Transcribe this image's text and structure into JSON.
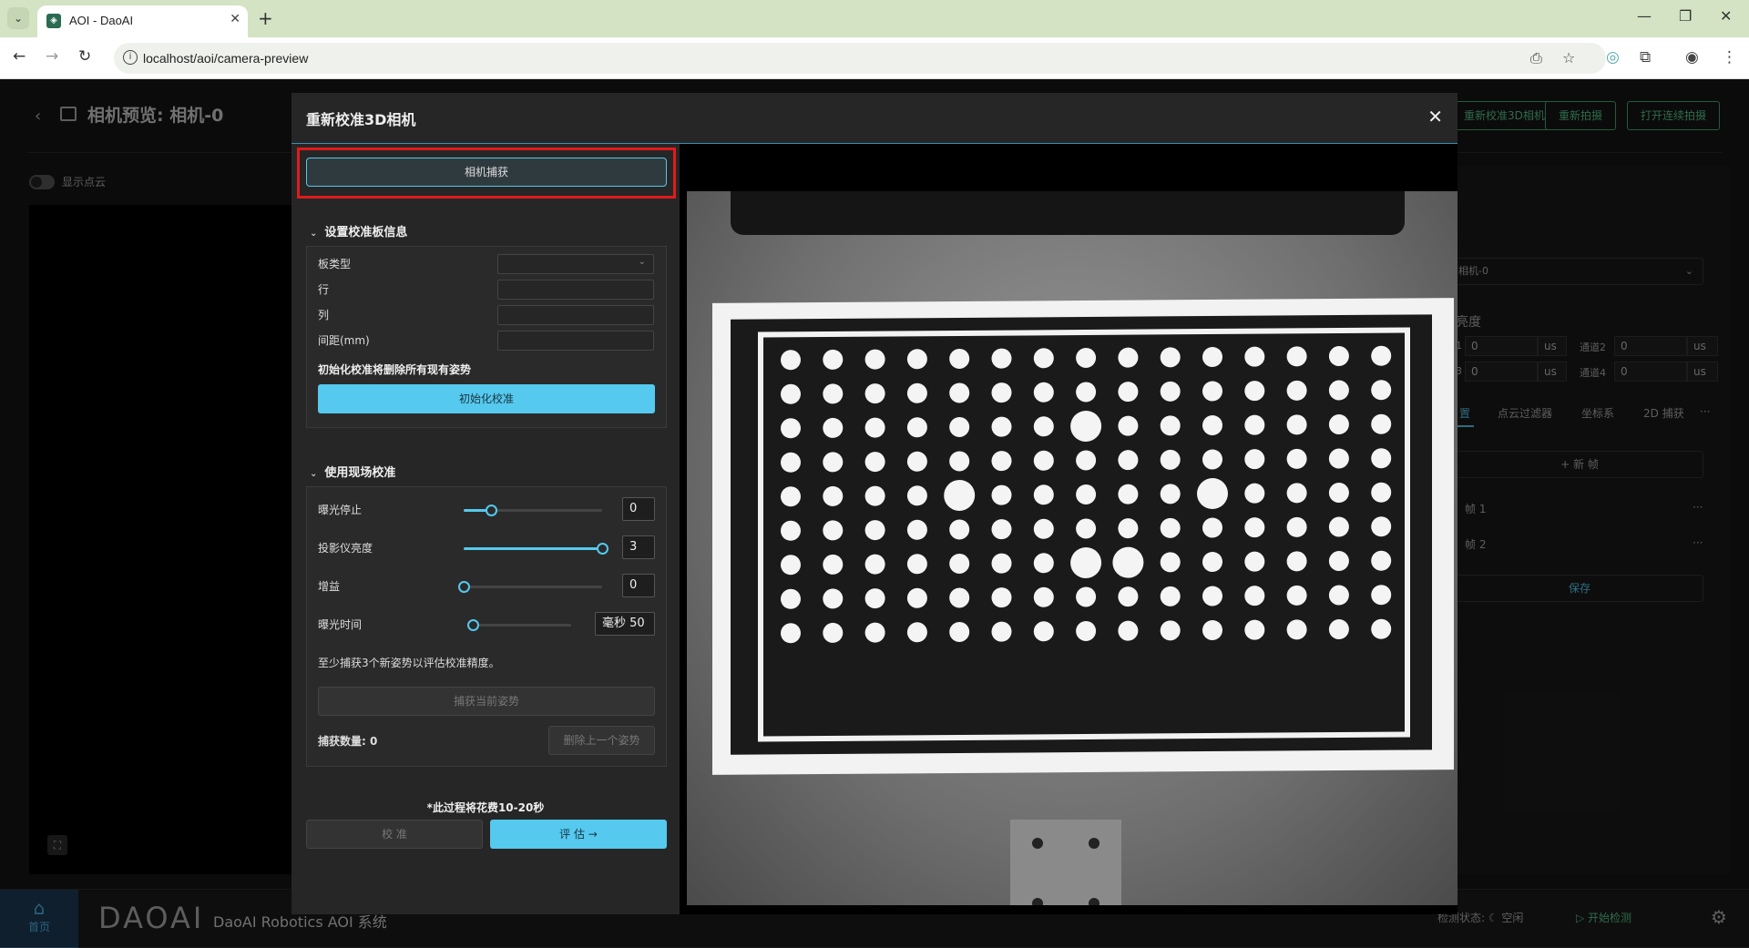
{
  "browser": {
    "tab_title": "AOI - DaoAI",
    "url": "localhost/aoi/camera-preview"
  },
  "app": {
    "page_title": "相机预览: 相机-0",
    "show_point_cloud": "显示点云",
    "header_buttons": [
      "重新校准3D相机",
      "重新拍摄",
      "打开连续拍摄"
    ],
    "right_panel": {
      "camera_select": "相机-0",
      "brightness_label": "亮度",
      "ch1_label": "1",
      "ch1_value": "0",
      "ch1_unit": "us",
      "ch2_label": "通道2",
      "ch2_value": "0",
      "ch2_unit": "us",
      "ch3_label": "3",
      "ch3_value": "0",
      "ch3_unit": "us",
      "ch4_label": "通道4",
      "ch4_value": "0",
      "ch4_unit": "us",
      "tabs": [
        "置",
        "点云过滤器",
        "坐标系",
        "2D 捕获",
        "···"
      ],
      "new_frame": "+ 新 帧",
      "frames": [
        "帧 1",
        "帧 2"
      ],
      "save": "保存"
    },
    "footer": {
      "home_label": "首页",
      "logo_text": "DAOAI",
      "system_name": "DaoAI Robotics AOI 系统",
      "detect_status": "检测状态: ☾ 空闲",
      "start_detect": "开始检测"
    }
  },
  "modal": {
    "title": "重新校准3D相机",
    "capture_button": "相机捕获",
    "section1_title": "设置校准板信息",
    "board_type_label": "板类型",
    "rows_label": "行",
    "cols_label": "列",
    "spacing_label": "间距(mm)",
    "init_warning": "初始化校准将删除所有现有姿势",
    "init_button": "初始化校准",
    "section2_title": "使用现场校准",
    "sliders": [
      {
        "label": "曝光停止",
        "value": "0",
        "fraction": 0.2
      },
      {
        "label": "投影仪亮度",
        "value": "3",
        "fraction": 1.0
      },
      {
        "label": "增益",
        "value": "0",
        "fraction": 0.0
      }
    ],
    "exposure_time_label": "曝光时间",
    "exposure_time_value": "毫秒 50",
    "exposure_time_fraction": 0.05,
    "min_pose_hint": "至少捕获3个新姿势以评估校准精度。",
    "capture_pose_button": "捕获当前姿势",
    "capture_count": "捕获数量: 0",
    "delete_last_button": "删除上一个姿势",
    "duration_note": "*此过程将花费10-20秒",
    "calibrate_button": "校 准",
    "evaluate_button": "评 估 →"
  }
}
